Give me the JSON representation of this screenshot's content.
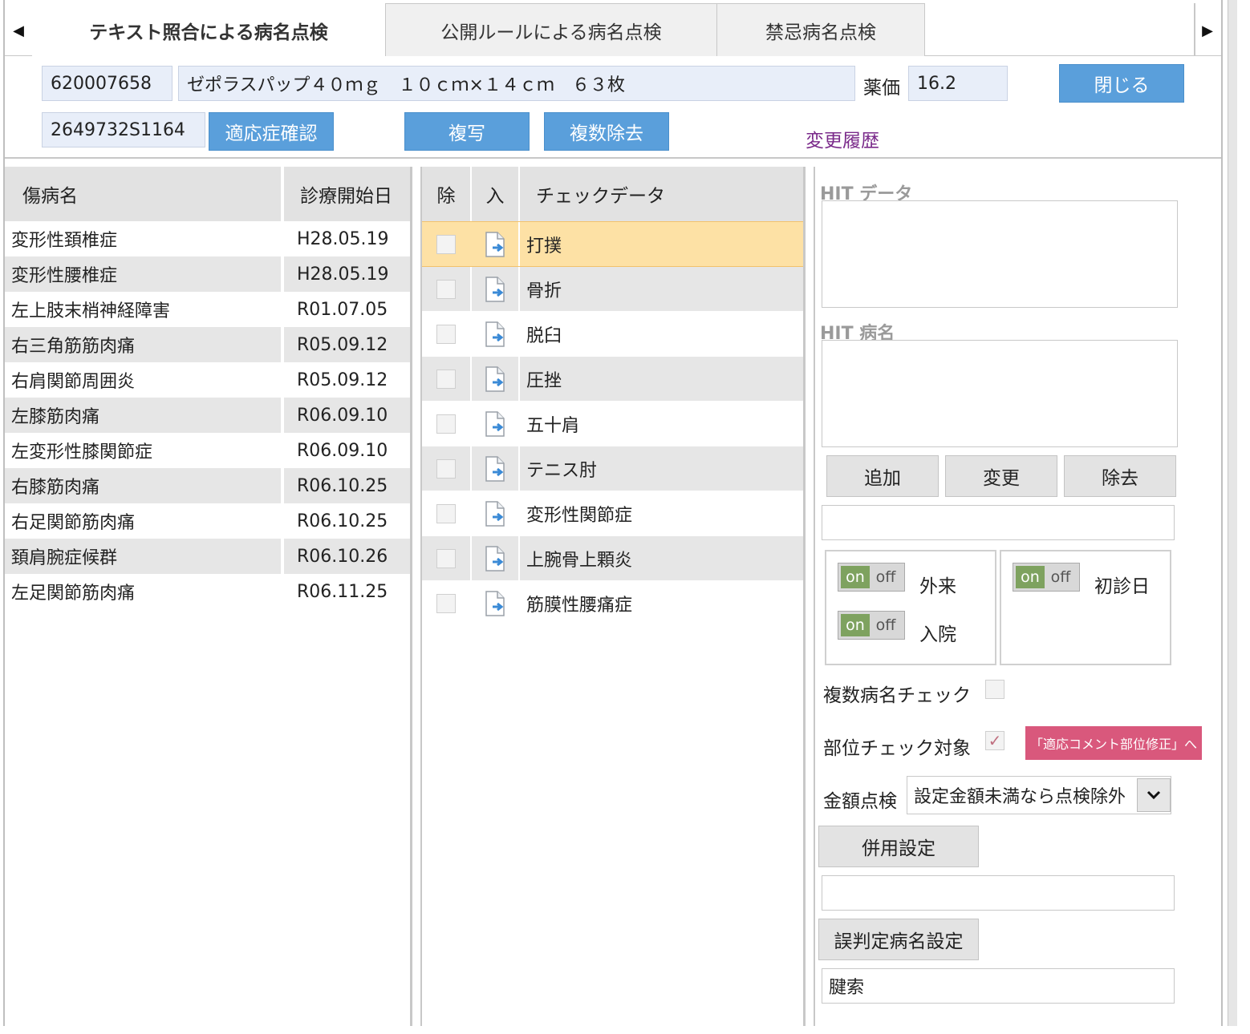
{
  "tabs": [
    {
      "label": "テキスト照合による病名点検"
    },
    {
      "label": "公開ルールによる病名点検"
    },
    {
      "label": "禁忌病名点検"
    }
  ],
  "nav": {
    "left_arrow": "◀",
    "right_arrow": "▶"
  },
  "drug": {
    "code": "620007658",
    "name": "ゼポラスパップ４０ｍｇ　１０ｃｍ×１４ｃｍ　６３枚",
    "price_label": "薬価",
    "price": "16.2",
    "yj_code": "2649732S1164"
  },
  "buttons": {
    "close": "閉じる",
    "indication": "適応症確認",
    "copy": "複写",
    "multi_remove": "複数除去",
    "history": "変更履歴",
    "add": "追加",
    "change": "変更",
    "remove": "除去",
    "combo": "併用設定",
    "misjudge": "誤判定病名設定"
  },
  "disease_table": {
    "headers": {
      "name": "傷病名",
      "date": "診療開始日"
    },
    "rows": [
      {
        "name": "変形性頚椎症",
        "date": "H28.05.19"
      },
      {
        "name": "変形性腰椎症",
        "date": "H28.05.19"
      },
      {
        "name": "左上肢末梢神経障害",
        "date": "R01.07.05"
      },
      {
        "name": "右三角筋筋肉痛",
        "date": "R05.09.12"
      },
      {
        "name": "右肩関節周囲炎",
        "date": "R05.09.12"
      },
      {
        "name": "左膝筋肉痛",
        "date": "R06.09.10"
      },
      {
        "name": "左変形性膝関節症",
        "date": "R06.09.10"
      },
      {
        "name": "右膝筋肉痛",
        "date": "R06.10.25"
      },
      {
        "name": "右足関節筋肉痛",
        "date": "R06.10.25"
      },
      {
        "name": "頚肩腕症候群",
        "date": "R06.10.26"
      },
      {
        "name": "左足関節筋肉痛",
        "date": "R06.11.25"
      }
    ]
  },
  "check_table": {
    "headers": {
      "remove": "除",
      "insert": "入",
      "data": "チェックデータ"
    },
    "rows": [
      {
        "label": "打撲"
      },
      {
        "label": "骨折"
      },
      {
        "label": "脱臼"
      },
      {
        "label": "圧挫"
      },
      {
        "label": "五十肩"
      },
      {
        "label": "テニス肘"
      },
      {
        "label": "変形性関節症"
      },
      {
        "label": "上腕骨上顆炎"
      },
      {
        "label": "筋膜性腰痛症"
      }
    ]
  },
  "right_panel": {
    "hit_data_label": "HIT データ",
    "hit_disease_label": "HIT 病名",
    "toggle_on": "on",
    "toggle_off": "off",
    "outpatient": "外来",
    "inpatient": "入院",
    "first_visit": "初診日",
    "multi_check": "複数病名チェック",
    "site_check": "部位チェック対象",
    "site_comment_btn": "「適応コメント部位修正」へ",
    "amount_label": "金額点検",
    "amount_select": "設定金額未満なら点検除外",
    "misjudge_value": "腱索"
  }
}
